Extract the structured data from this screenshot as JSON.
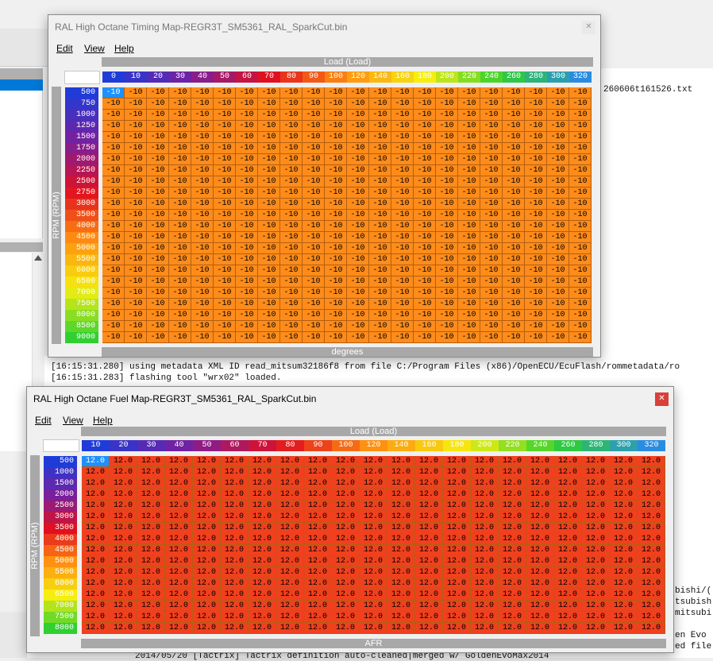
{
  "background": {
    "log_lines": [
      "[16:15:31.280] using metadata XML ID read_mitsum32186f8 from file C:/Program Files (x86)/OpenECU/EcuFlash/rommetadata/ro",
      "[16:15:31.283] flashing tool \"wrx02\" loaded."
    ],
    "partial_top_right": "260606t161526.txt",
    "partial_right": [
      "bishi/(",
      "tsubish:",
      "mitsubi:",
      "",
      "en Evo :",
      "ed file"
    ],
    "partial_bottom": "2014/05/20 [Tactrix] Tactrix definition auto-cleaned|merged w/ GoldenEvoMax2014"
  },
  "timing_window": {
    "title": "RAL High Octane Timing Map-REGR3T_SM5361_RAL_SparkCut.bin",
    "menu": [
      "Edit",
      "View",
      "Help"
    ],
    "x_axis_label": "Load (Load)",
    "y_axis_label": "RPM (RPM)",
    "units_label": "degrees",
    "columns": [
      "0",
      "10",
      "20",
      "30",
      "40",
      "50",
      "60",
      "70",
      "80",
      "90",
      "100",
      "120",
      "140",
      "160",
      "180",
      "200",
      "220",
      "240",
      "260",
      "280",
      "300",
      "320"
    ],
    "rows": [
      "500",
      "750",
      "1000",
      "1250",
      "1500",
      "1750",
      "2000",
      "2250",
      "2500",
      "2750",
      "3000",
      "3500",
      "4000",
      "4500",
      "5000",
      "5500",
      "6000",
      "6500",
      "7000",
      "7500",
      "8000",
      "8500",
      "9000"
    ],
    "cell_value": "-10",
    "cell_color": "#ff8c1a"
  },
  "fuel_window": {
    "title": "RAL High Octane Fuel Map-REGR3T_SM5361_RAL_SparkCut.bin",
    "menu": [
      "Edit",
      "View",
      "Help"
    ],
    "x_axis_label": "Load (Load)",
    "y_axis_label": "RPM (RPM)",
    "units_label": "AFR",
    "columns": [
      "10",
      "20",
      "30",
      "40",
      "50",
      "60",
      "70",
      "80",
      "90",
      "100",
      "120",
      "140",
      "160",
      "180",
      "200",
      "220",
      "240",
      "260",
      "280",
      "300",
      "320"
    ],
    "rows": [
      "500",
      "1000",
      "1500",
      "2000",
      "2500",
      "3000",
      "3500",
      "4000",
      "4500",
      "5000",
      "5500",
      "6000",
      "6500",
      "7000",
      "7500",
      "8000"
    ],
    "cell_value": "12.0",
    "cell_color": "#f0401e"
  },
  "colors": {
    "close_button": "#d9403a",
    "header_blue": "#1f3cd8",
    "header_purple": "#7a1f9c",
    "header_red": "#e01020",
    "header_orange": "#ff9010",
    "header_yellow": "#f5ee10",
    "header_green": "#30d030"
  }
}
